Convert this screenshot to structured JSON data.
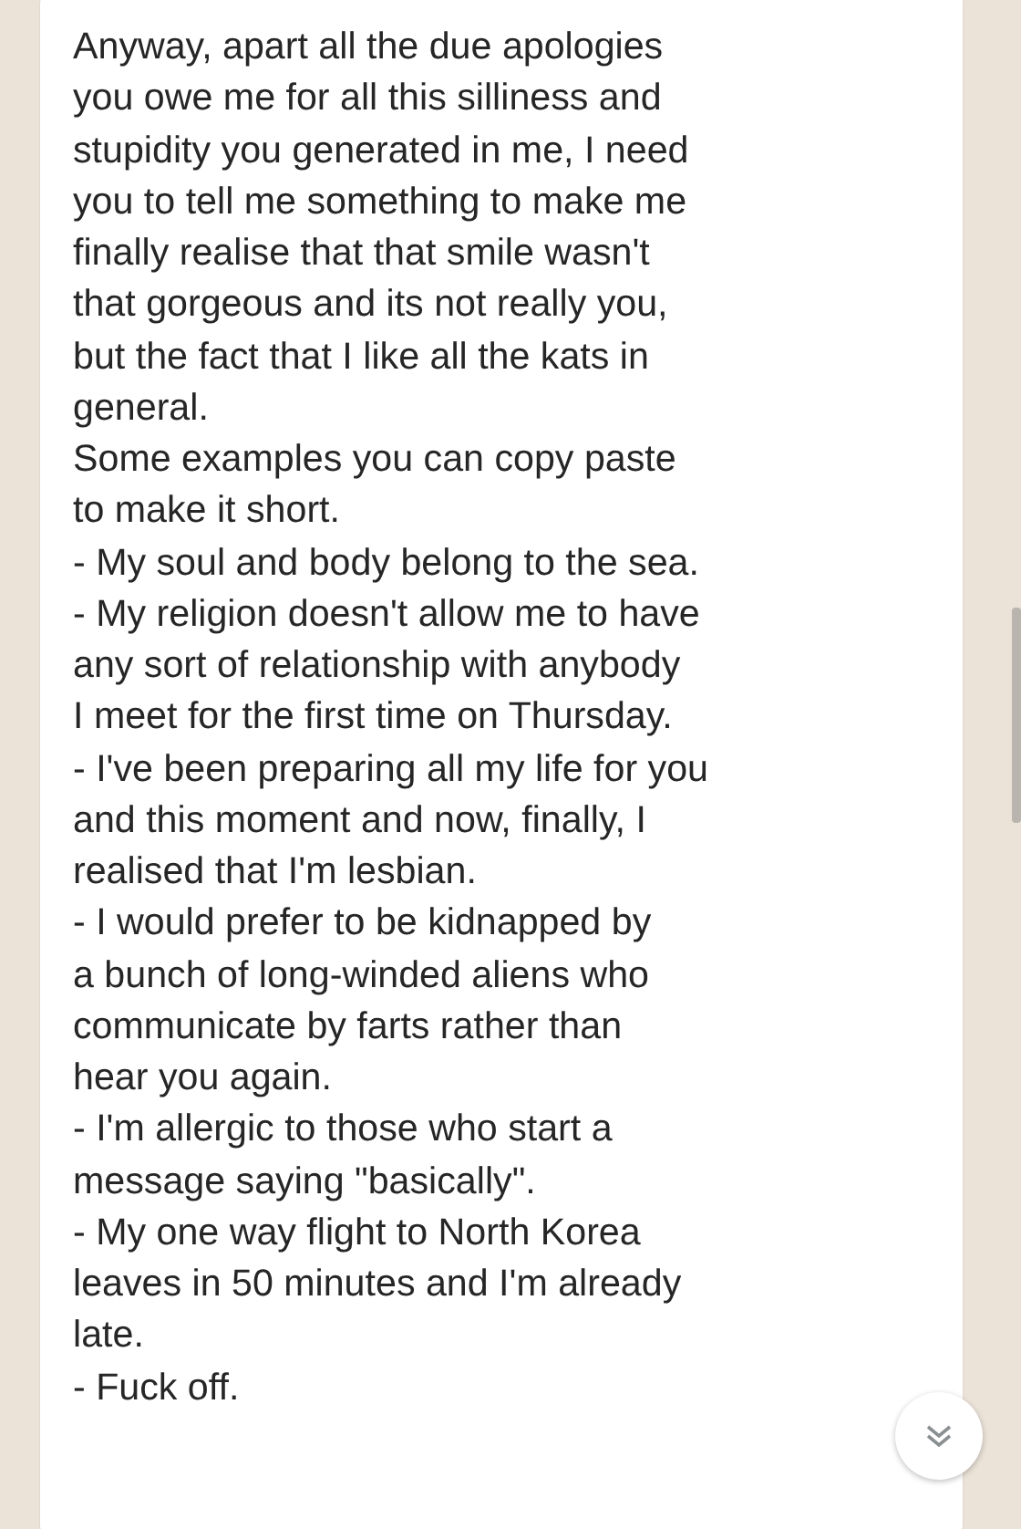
{
  "message": {
    "lines": [
      "Anyway, apart all the due apologies",
      "you owe me for all this silliness and",
      "stupidity you generated in me, I need",
      "you to tell me something to make me",
      "finally realise that that smile wasn't",
      "that gorgeous and its not really you,",
      "but the fact that I like all the kats in",
      "general.",
      "Some examples you can copy paste",
      "to make it short.",
      "- My soul and body belong to the sea.",
      "- My religion doesn't allow me to have",
      "any sort of relationship with anybody",
      "I meet for the first time on Thursday.",
      "- I've been preparing all my life for you",
      "and this moment and now, finally, I",
      "realised that I'm lesbian.",
      "- I would prefer to be kidnapped by",
      "a bunch of long-winded aliens who",
      "communicate by farts rather than",
      "hear you again.",
      "- I'm allergic to those who start a",
      "message saying \"basically\".",
      "- My one way flight to North Korea",
      "leaves in 50 minutes and I'm already",
      "late.",
      "- Fuck off."
    ]
  }
}
